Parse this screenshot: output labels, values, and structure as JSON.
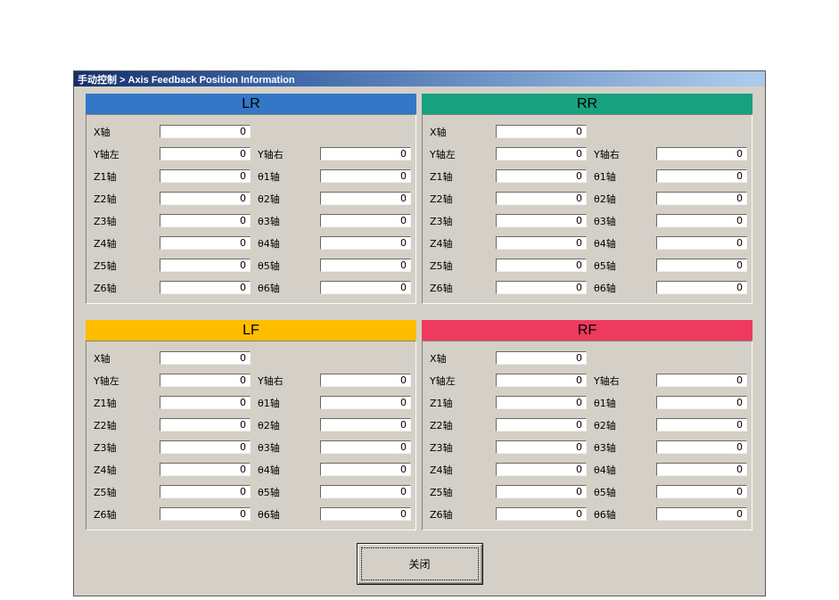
{
  "window": {
    "title": "手动控制 > Axis Feedback Position Information",
    "body_color": "#d4d0c8"
  },
  "panels": [
    {
      "id": "lr",
      "title": "LR",
      "color": "#3377c6"
    },
    {
      "id": "rr",
      "title": "RR",
      "color": "#17a17e"
    },
    {
      "id": "lf",
      "title": "LF",
      "color": "#ffbd00"
    },
    {
      "id": "rf",
      "title": "RF",
      "color": "#ee3a5e"
    }
  ],
  "axis_rows": [
    {
      "left_label": "X轴",
      "left_value": "0",
      "right_label": "",
      "right_value": null
    },
    {
      "left_label": "Y轴左",
      "left_value": "0",
      "right_label": "Y轴右",
      "right_value": "0"
    },
    {
      "left_label": "Z1轴",
      "left_value": "0",
      "right_label": "θ1轴",
      "right_value": "0"
    },
    {
      "left_label": "Z2轴",
      "left_value": "0",
      "right_label": "θ2轴",
      "right_value": "0"
    },
    {
      "left_label": "Z3轴",
      "left_value": "0",
      "right_label": "θ3轴",
      "right_value": "0"
    },
    {
      "left_label": "Z4轴",
      "left_value": "0",
      "right_label": "θ4轴",
      "right_value": "0"
    },
    {
      "left_label": "Z5轴",
      "left_value": "0",
      "right_label": "θ5轴",
      "right_value": "0"
    },
    {
      "left_label": "Z6轴",
      "left_value": "0",
      "right_label": "θ6轴",
      "right_value": "0"
    }
  ],
  "close_button": {
    "label": "关闭"
  }
}
